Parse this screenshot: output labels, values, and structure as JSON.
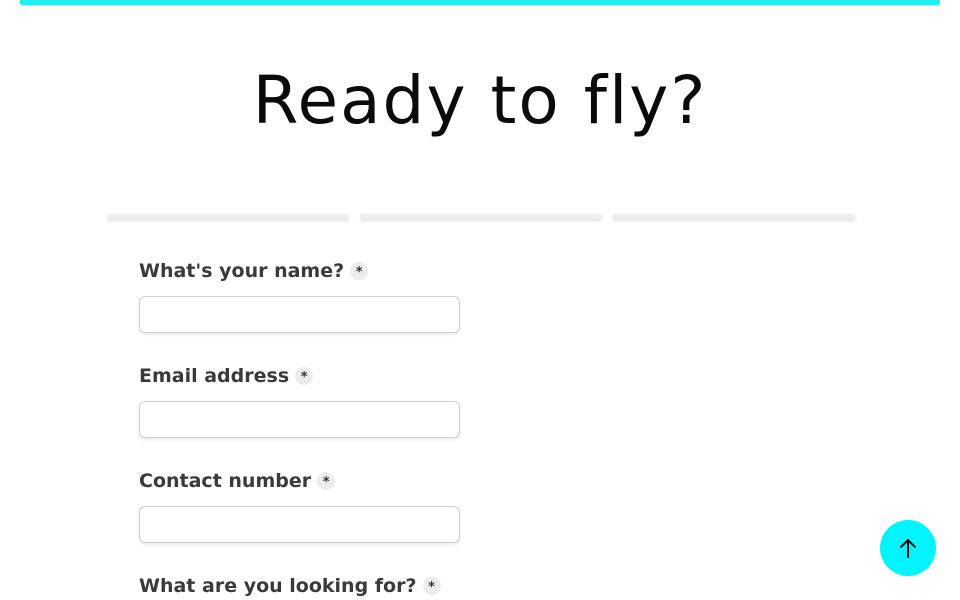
{
  "hero": {
    "title": "Ready to fly?"
  },
  "steps": {
    "count": 3
  },
  "form": {
    "fields": [
      {
        "label": "What's your name?",
        "required_mark": "*",
        "value": "",
        "placeholder": ""
      },
      {
        "label": "Email address",
        "required_mark": "*",
        "value": "",
        "placeholder": ""
      },
      {
        "label": "Contact number",
        "required_mark": "*",
        "value": "",
        "placeholder": ""
      },
      {
        "label": "What are you looking for?",
        "required_mark": "*"
      }
    ]
  },
  "colors": {
    "accent": "#00f5ff",
    "top_bar": "#1ff0f0"
  },
  "icons": {
    "scroll_top": "arrow-up-icon"
  }
}
